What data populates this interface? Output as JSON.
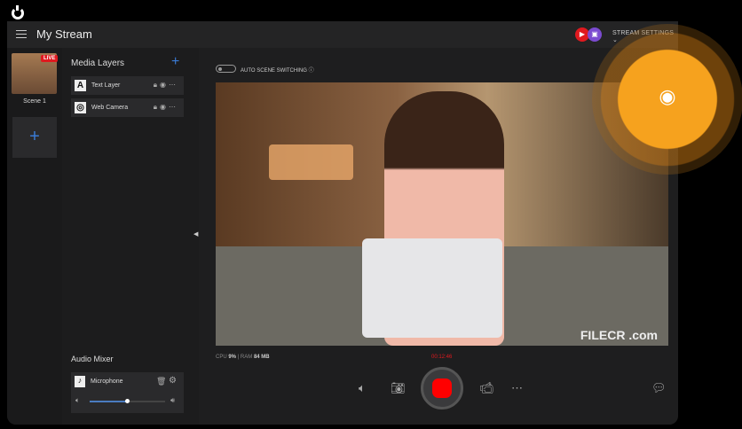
{
  "app": {
    "title": "My Stream"
  },
  "header": {
    "platforms": [
      "YouTube",
      "Twitch"
    ],
    "stream_settings": "STREAM SETTINGS"
  },
  "scenes": {
    "live_badge": "LIVE",
    "items": [
      {
        "label": "Scene 1"
      }
    ],
    "add": "+"
  },
  "media_layers": {
    "title": "Media Layers",
    "add": "+",
    "items": [
      {
        "label": "Text Layer",
        "icon": "A"
      },
      {
        "label": "Web Camera",
        "icon": "◎"
      }
    ]
  },
  "audio_mixer": {
    "title": "Audio Mixer",
    "items": [
      {
        "label": "Microphone",
        "volume": 0.5
      }
    ]
  },
  "main": {
    "auto_scene": "AUTO SCENE SWITCHING",
    "cpu_label": "CPU",
    "cpu": "9%",
    "ram_label": "RAM",
    "ram": "84 MB",
    "timer": "00:12:46",
    "watermark": "FILECR .com"
  },
  "colors": {
    "accent": "#f6a21e",
    "record": "#ff0000",
    "live": "#e0191f",
    "add": "#3a7bd5"
  }
}
